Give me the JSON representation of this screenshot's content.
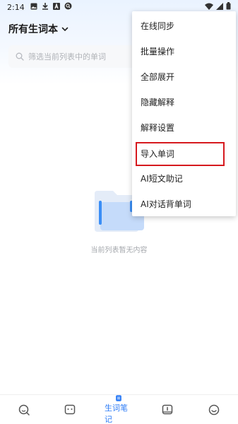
{
  "status_bar": {
    "time": "2:14"
  },
  "header": {
    "title": "所有生词本"
  },
  "search": {
    "placeholder": "筛选当前列表中的单词"
  },
  "empty_state": {
    "text": "当前列表暂无内容"
  },
  "menu": {
    "items": [
      {
        "label": "在线同步"
      },
      {
        "label": "批量操作"
      },
      {
        "label": "全部展开"
      },
      {
        "label": "隐藏解释"
      },
      {
        "label": "解释设置"
      },
      {
        "label": "导入单词"
      },
      {
        "label": "AI短文助记"
      },
      {
        "label": "AI对话背单词"
      }
    ],
    "highlighted_item": "导入单词"
  },
  "bottom_nav": {
    "items": [
      {
        "icon": "search-icon",
        "label": ""
      },
      {
        "icon": "chat-icon",
        "label": ""
      },
      {
        "icon": "wordbook-icon",
        "label": "生词笔记",
        "active": true
      },
      {
        "icon": "flag-icon",
        "label": ""
      },
      {
        "icon": "smile-icon",
        "label": ""
      }
    ]
  },
  "colors": {
    "accent": "#2f7df6",
    "highlight_border": "#d6191e",
    "muted_text": "#a5a8ad"
  }
}
